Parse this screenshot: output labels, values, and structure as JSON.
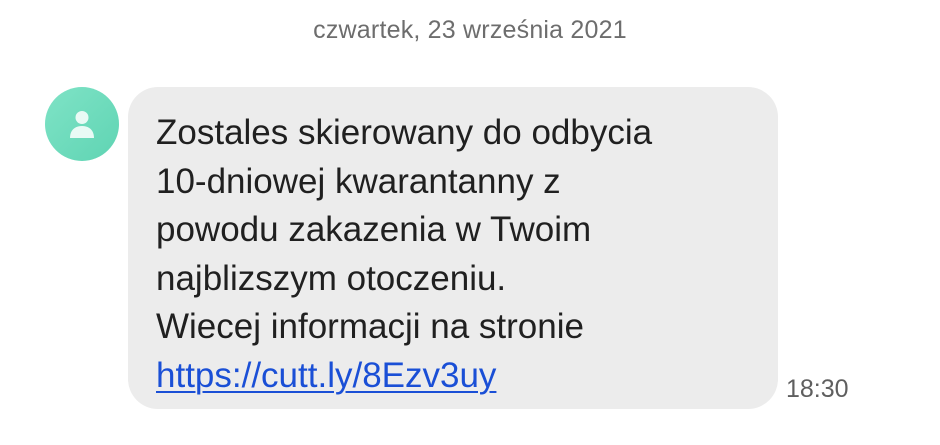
{
  "conversation": {
    "date_header": "czwartek, 23 września 2021"
  },
  "message": {
    "lines": [
      "Zostales skierowany do odbycia",
      "10-dniowej kwarantanny z",
      "powodu zakazenia w Twoim",
      "najblizszym otoczeniu.",
      "Wiecej informacji na stronie"
    ],
    "link": "https://cutt.ly/8Ezv3uy",
    "time": "18:30"
  },
  "colors": {
    "avatar": "#6fdcbc",
    "bubble": "#ececec",
    "link": "#1a4fd6"
  },
  "icons": {
    "avatar": "person-icon"
  }
}
